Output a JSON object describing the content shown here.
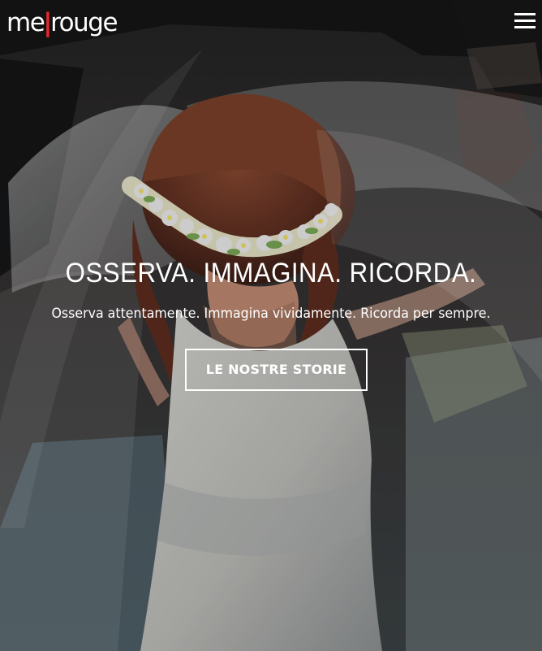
{
  "header": {
    "logo_prefix": "me",
    "logo_accent": "|",
    "logo_suffix": "rouge",
    "menu_icon": "hamburger-menu-icon"
  },
  "hero": {
    "image_subject": "bride-with-flower-crown-and-veil",
    "title": "OSSERVA. IMMAGINA. RICORDA.",
    "subtitle": "Osserva attentamente. Immagina vividamente. Ricorda per sempre.",
    "cta_label": "LE NOSTRE STORIE"
  },
  "colors": {
    "brand_accent": "#e8262b",
    "text": "#ffffff",
    "overlay": "#1b1b1b"
  }
}
